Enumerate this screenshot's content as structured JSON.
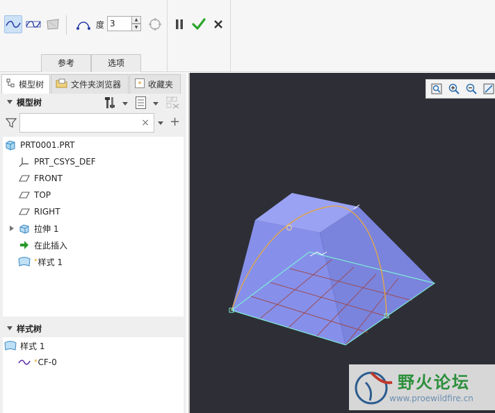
{
  "ribbon": {
    "degree_label": "度",
    "degree_value": "3",
    "tabs": [
      "参考",
      "选项"
    ],
    "tools": [
      "interp-curve-icon",
      "control-curve-icon",
      "surface-icon",
      "curve-through-points-icon",
      "free-form-icon",
      "pause-icon",
      "confirm-icon",
      "cancel-icon"
    ]
  },
  "panel": {
    "tabs": [
      {
        "label": "模型树",
        "icon": "model-tree-icon"
      },
      {
        "label": "文件夹浏览器",
        "icon": "folder-browser-icon"
      },
      {
        "label": "收藏夹",
        "icon": "favorites-icon"
      }
    ],
    "model_tree_title": "模型树",
    "filter_placeholder": "",
    "model_tree": [
      {
        "label": "PRT0001.PRT",
        "icon": "part-icon"
      },
      {
        "label": "PRT_CSYS_DEF",
        "icon": "csys-icon"
      },
      {
        "label": "FRONT",
        "icon": "datum-plane-icon"
      },
      {
        "label": "TOP",
        "icon": "datum-plane-icon"
      },
      {
        "label": "RIGHT",
        "icon": "datum-plane-icon"
      },
      {
        "label": "拉伸 1",
        "icon": "extrude-icon"
      },
      {
        "label": "在此插入",
        "icon": "insert-here-icon"
      },
      {
        "label": "样式 1",
        "icon": "style-icon"
      }
    ],
    "style_tree_title": "样式树",
    "style_tree": [
      {
        "label": "样式 1",
        "icon": "style-icon"
      },
      {
        "label": "CF-0",
        "icon": "curve-icon"
      }
    ]
  },
  "viewport": {
    "view_tools": [
      "refit-icon",
      "zoom-in-icon",
      "zoom-out-icon",
      "repaint-icon"
    ],
    "background_color": "#2e2f36",
    "watermark": {
      "title": "野火论坛",
      "url": "www.proewildfire.cn"
    }
  },
  "colors": {
    "accent": "#2a77c9",
    "model_face": "#8c95f0",
    "curve": "#e3a64a",
    "grid": "#9c4b55",
    "edge": "#7ff0d8",
    "confirm": "#2aa42a"
  }
}
